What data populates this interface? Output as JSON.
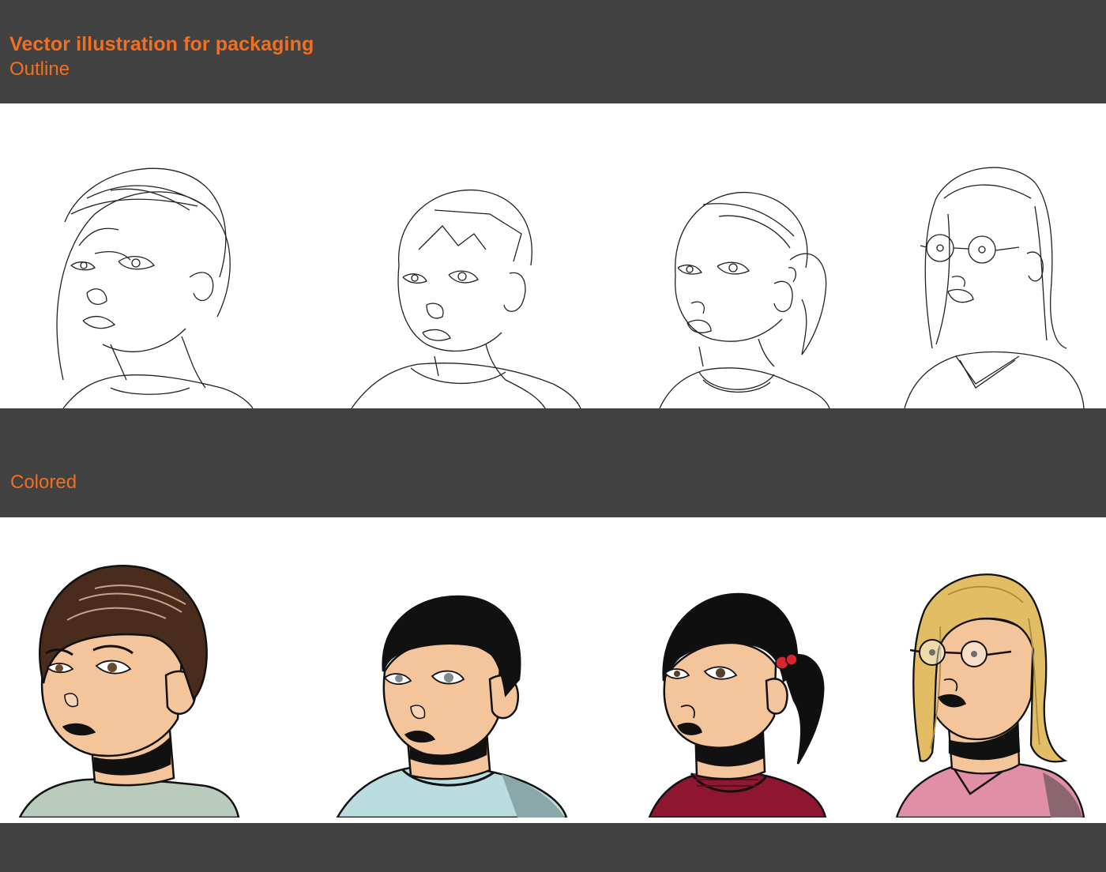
{
  "colors": {
    "accent": "#f26f21",
    "band": "#414141",
    "panel": "#ffffff"
  },
  "header": {
    "title": "Vector illustration for packaging",
    "subtitle": "Outline"
  },
  "sections": {
    "colored_label": "Colored"
  },
  "portraits": [
    {
      "name": "boy-brown-hair",
      "hair": "#4a2c1d",
      "shirt": "#b9cbbd",
      "skin": "#f4c49a",
      "eye": "#6b4a2c"
    },
    {
      "name": "boy-black-hair",
      "hair": "#111111",
      "shirt": "#bcdde0",
      "skin": "#f4c49a",
      "eye": "#7e8a8c"
    },
    {
      "name": "girl-ponytail",
      "hair": "#0f0f0f",
      "shirt": "#8e1630",
      "skin": "#f4c49a",
      "eye": "#5a3f2a",
      "accessory": "#d8262f"
    },
    {
      "name": "girl-blonde-glasses",
      "hair": "#e2bd63",
      "shirt": "#e08fa6",
      "skin": "#f4c49a",
      "eye": "#6d6d6d"
    }
  ]
}
